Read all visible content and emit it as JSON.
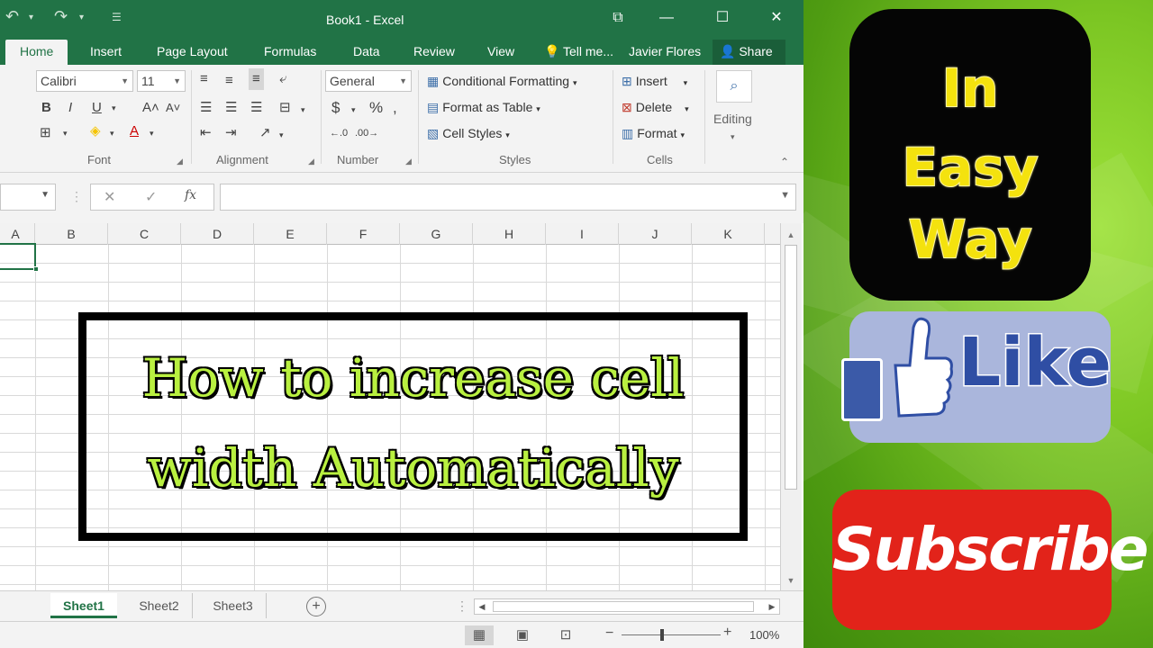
{
  "window": {
    "title": "Book1 - Excel"
  },
  "tabs": [
    "Home",
    "Insert",
    "Page Layout",
    "Formulas",
    "Data",
    "Review",
    "View"
  ],
  "tell_me": "Tell me...",
  "user": "Javier Flores",
  "share_label": "Share",
  "ribbon": {
    "font_name": "Calibri",
    "font_size": "11",
    "number_format": "General",
    "groups": [
      "Font",
      "Alignment",
      "Number",
      "Styles",
      "Cells"
    ],
    "styles": [
      "Conditional Formatting",
      "Format as Table",
      "Cell Styles"
    ],
    "cells": [
      "Insert",
      "Delete",
      "Format"
    ],
    "editing": "Editing"
  },
  "columns": [
    "A",
    "B",
    "C",
    "D",
    "E",
    "F",
    "G",
    "H",
    "I",
    "J",
    "K"
  ],
  "sheets": [
    "Sheet1",
    "Sheet2",
    "Sheet3"
  ],
  "zoom": "100%",
  "overlay": {
    "line1": "How to increase cell",
    "line2": "width Automatically"
  },
  "promo": {
    "easy": [
      "In",
      "Easy",
      "Way"
    ],
    "like": "Like",
    "subscribe": "Subscribe"
  },
  "colors": {
    "excel_green": "#217346",
    "title_text": "#b9f040",
    "easy_text": "#f4e20e",
    "like_blue": "#2f4ea4",
    "subscribe_red": "#e2231a"
  }
}
